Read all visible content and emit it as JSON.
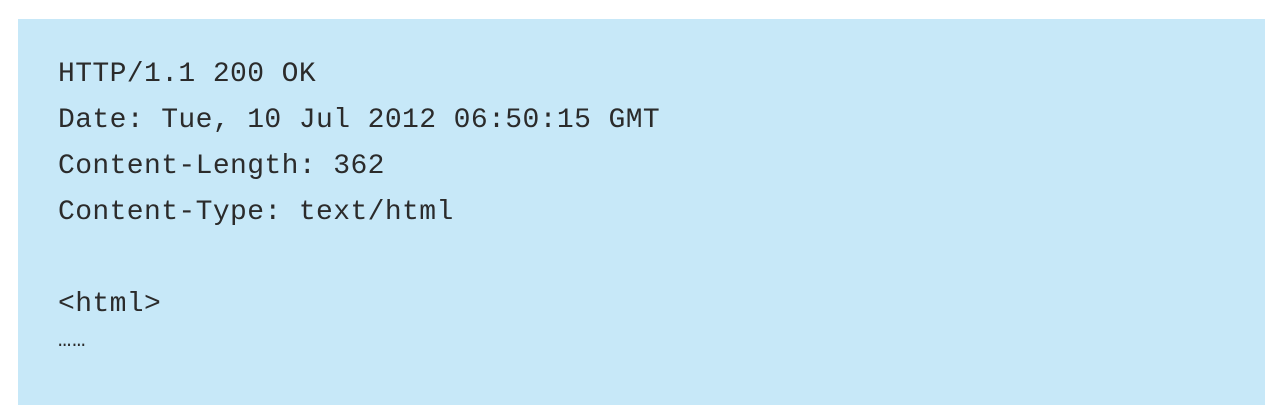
{
  "http_response": {
    "status_line": "HTTP/1.1 200 OK",
    "headers": [
      "Date: Tue, 10 Jul 2012 06:50:15 GMT",
      "Content-Length: 362",
      "Content-Type: text/html"
    ],
    "body_lines": [
      "<html>",
      "……"
    ]
  },
  "colors": {
    "box_background": "#c7e8f8",
    "text": "#2b2b2b"
  }
}
